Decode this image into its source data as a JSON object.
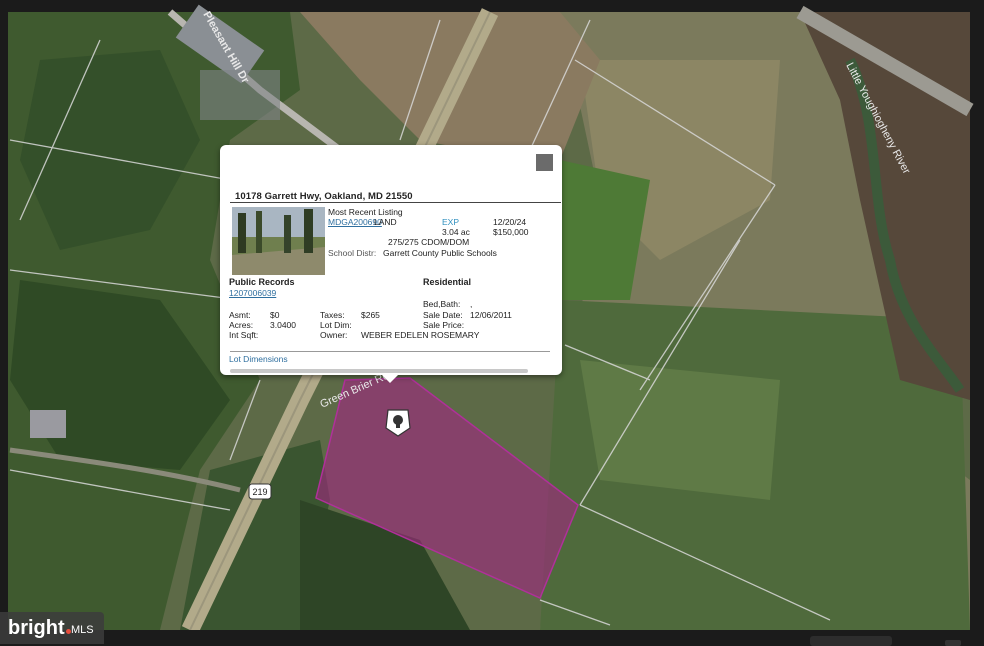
{
  "map": {
    "road_labels": {
      "pleasant_hill": "Pleasant Hill Dr",
      "little_youghiogheny": "Little Youghiogheny River",
      "green_brier": "Green Brier Rd",
      "route_219": "219"
    }
  },
  "popup": {
    "address": "10178 Garrett Hwy, Oakland, MD 21550",
    "listing": {
      "title": "Most Recent Listing",
      "mls_id": "MDGA200690",
      "type": "LAND",
      "status": "EXP",
      "date": "12/20/24",
      "acres": "3.04 ac",
      "price": "$150,000",
      "cdom": "275/275 CDOM/DOM",
      "school_label": "School Distr:",
      "school": "Garrett County Public Schools"
    },
    "public_records": {
      "title": "Public Records",
      "tax_id": "1207006039",
      "category": "Residential",
      "asmt_label": "Asmt:",
      "asmt": "$0",
      "taxes_label": "Taxes:",
      "taxes": "$265",
      "acres_label": "Acres:",
      "acres": "3.0400",
      "lot_dim_label": "Lot Dim:",
      "lot_dim": "",
      "int_sqft_label": "Int Sqft:",
      "int_sqft": "",
      "owner_label": "Owner:",
      "owner": "WEBER EDELEN ROSEMARY",
      "bed_bath_label": "Bed,Bath:",
      "bed_bath": ",",
      "sale_date_label": "Sale Date:",
      "sale_date": "12/06/2011",
      "sale_price_label": "Sale Price:",
      "sale_price": ""
    },
    "lot_dimensions_link": "Lot Dimensions"
  },
  "watermark": {
    "brand": "bright",
    "suffix": "MLS"
  },
  "colors": {
    "parcel": "#a0287f",
    "link": "#2f6f9f"
  }
}
